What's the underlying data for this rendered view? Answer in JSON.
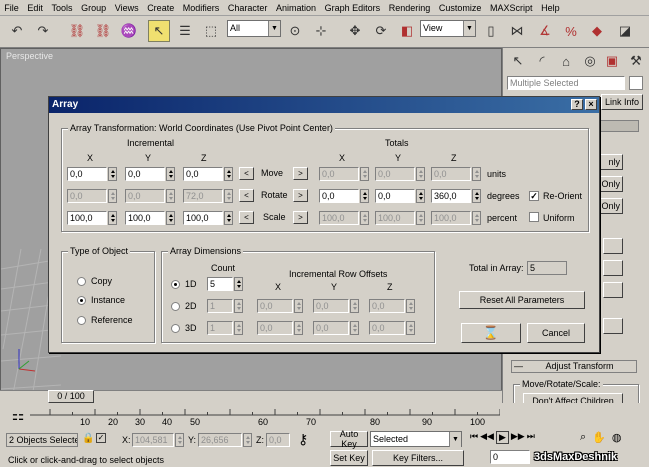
{
  "menu": [
    "File",
    "Edit",
    "Tools",
    "Group",
    "Views",
    "Create",
    "Modifiers",
    "Character",
    "Animation",
    "Graph Editors",
    "Rendering",
    "Customize",
    "MAXScript",
    "Help"
  ],
  "toolbar": {
    "filter_value": "All",
    "refcoord_value": "View"
  },
  "viewport": {
    "label": "Perspective"
  },
  "command_panel": {
    "selection_label": "Multiple Selected",
    "link_info_tab": "Link Info",
    "btn_only_1": "nly",
    "btn_only_2": "Only",
    "btn_only_3": "Only",
    "adjust_transform": "Adjust Transform",
    "move_rotate_scale": "Move/Rotate/Scale:",
    "dont_affect_children": "Don't Affect Children"
  },
  "dialog": {
    "title": "Array",
    "help_btn": "?",
    "close_btn": "×",
    "transformation": {
      "group_title": "Array Transformation: World Coordinates (Use Pivot Point Center)",
      "incremental_label": "Incremental",
      "totals_label": "Totals",
      "x": "X",
      "y": "Y",
      "z": "Z",
      "rows": [
        {
          "name": "Move",
          "inc": [
            "0,0",
            "0,0",
            "0,0"
          ],
          "tot": [
            "0,0",
            "0,0",
            "0,0"
          ],
          "unit": "units",
          "left": "<",
          "right": ">"
        },
        {
          "name": "Rotate",
          "inc": [
            "0,0",
            "0,0",
            "72,0"
          ],
          "tot": [
            "0,0",
            "0,0",
            "360,0"
          ],
          "unit": "degrees",
          "left": "<",
          "right": ">"
        },
        {
          "name": "Scale",
          "inc": [
            "100,0",
            "100,0",
            "100,0"
          ],
          "tot": [
            "100,0",
            "100,0",
            "100,0"
          ],
          "unit": "percent",
          "left": "<",
          "right": ">"
        }
      ],
      "re_orient": "Re-Orient",
      "uniform": "Uniform"
    },
    "type_of_object": {
      "group_title": "Type of Object",
      "copy": "Copy",
      "instance": "Instance",
      "reference": "Reference",
      "selected": "instance"
    },
    "array_dimensions": {
      "group_title": "Array Dimensions",
      "count_label": "Count",
      "row_offsets_label": "Incremental Row Offsets",
      "x": "X",
      "y": "Y",
      "z": "Z",
      "rows": [
        {
          "label": "1D",
          "count": "5",
          "offsets": [
            "",
            "",
            ""
          ],
          "selected": true
        },
        {
          "label": "2D",
          "count": "1",
          "offsets": [
            "0,0",
            "0,0",
            "0,0"
          ],
          "selected": false
        },
        {
          "label": "3D",
          "count": "1",
          "offsets": [
            "0,0",
            "0,0",
            "0,0"
          ],
          "selected": false
        }
      ]
    },
    "total_in_array_label": "Total in Array:",
    "total_in_array_value": "5",
    "reset_all_parameters": "Reset All Parameters",
    "cancel": "Cancel"
  },
  "timeline": {
    "slider_value": "0 / 100",
    "ticks": [
      "10",
      "20",
      "30",
      "40",
      "50",
      "60",
      "70",
      "80",
      "90",
      "100"
    ]
  },
  "status": {
    "selection": "2 Objects Selecte",
    "x_label": "X:",
    "x_value": "104,581",
    "y_label": "Y:",
    "y_value": "26,656",
    "z_label": "Z:",
    "z_value": "0,0",
    "auto_key": "Auto Key",
    "set_key": "Set Key",
    "key_mode_value": "Selected",
    "key_filters": "Key Filters...",
    "frame_value": "0",
    "prompt": "Click or click-and-drag to select objects"
  },
  "watermark": "3dsMaxDeshnik"
}
